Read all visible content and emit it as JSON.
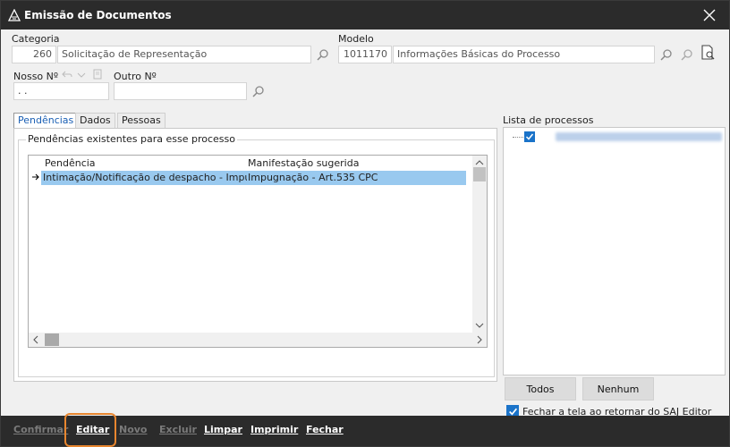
{
  "window": {
    "title": "Emissão de Documentos"
  },
  "form": {
    "categoria": {
      "label": "Categoria",
      "code": "260",
      "description": "Solicitação de Representação"
    },
    "modelo": {
      "label": "Modelo",
      "code": "1011170",
      "description": "Informações Básicas do Processo"
    },
    "nosso_no": {
      "label": "Nosso Nº",
      "value": ". ."
    },
    "outro_no": {
      "label": "Outro Nº",
      "value": ""
    }
  },
  "tabs": [
    {
      "label": "Pendências",
      "active": true
    },
    {
      "label": "Dados",
      "active": false
    },
    {
      "label": "Pessoas",
      "active": false
    }
  ],
  "pendencias": {
    "group_title": "Pendências existentes para esse processo",
    "columns": [
      "Pendência",
      "Manifestação sugerida"
    ],
    "rows": [
      {
        "pendencia": "Intimação/Notificação de despacho - Impugnação",
        "manifestacao": "Impugnação - Art.535 CPC"
      }
    ]
  },
  "lista_processos": {
    "label": "Lista de processos"
  },
  "right_buttons": {
    "todos": "Todos",
    "nenhum": "Nenhum"
  },
  "fechar_checkbox": {
    "label": "Fechar a tela ao retornar do SAJ Editor",
    "checked": true
  },
  "toolbar": {
    "confirmar": "Confirmar",
    "editar": "Editar",
    "novo": "Novo",
    "excluir": "Excluir",
    "limpar": "Limpar",
    "imprimir": "Imprimir",
    "fechar": "Fechar"
  },
  "colors": {
    "accent": "#1a73c9",
    "selection": "#99c9ef",
    "highlight": "#e8862f",
    "titlebar": "#2b2b2b"
  }
}
